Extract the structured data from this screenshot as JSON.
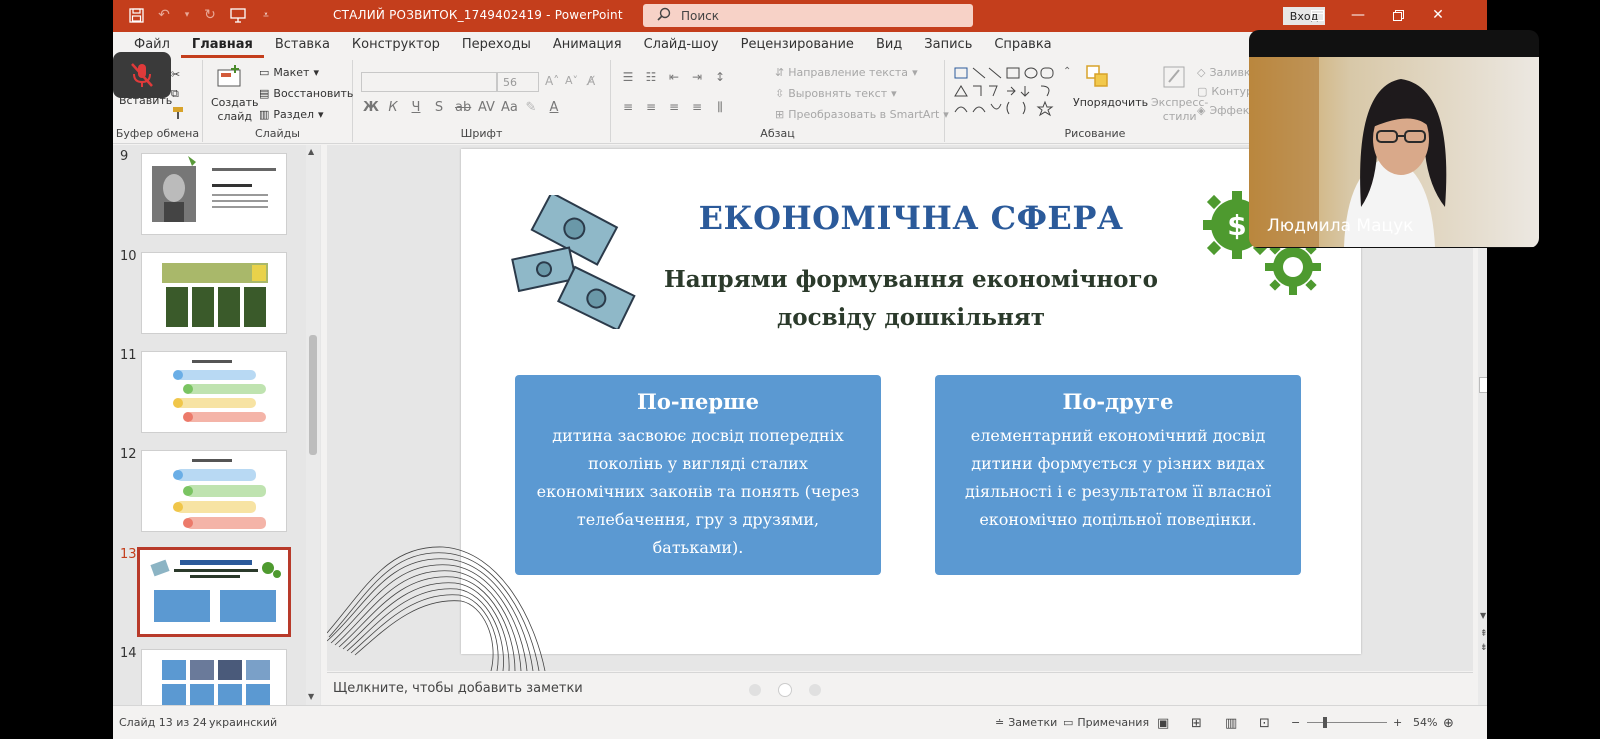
{
  "titlebar": {
    "doc_title": "СТАЛИЙ РОЗВИТОК_1749402419  -  PowerPoint",
    "search_placeholder": "Поиск",
    "signin_label": "Вход"
  },
  "ribbon_tabs": [
    "Файл",
    "Главная",
    "Вставка",
    "Конструктор",
    "Переходы",
    "Анимация",
    "Слайд-шоу",
    "Рецензирование",
    "Вид",
    "Запись",
    "Справка"
  ],
  "ribbon": {
    "clipboard": {
      "paste_label": "Вставить",
      "group_label": "Буфер обмена"
    },
    "slides": {
      "new_slide_label": "Создать\nслайд",
      "layout_label": "Макет",
      "reset_label": "Восстановить",
      "section_label": "Раздел",
      "group_label": "Слайды"
    },
    "font": {
      "size_value": "56",
      "group_label": "Шрифт"
    },
    "paragraph": {
      "text_direction": "Направление текста",
      "align_text": "Выровнять текст",
      "smartart": "Преобразовать в SmartArt",
      "group_label": "Абзац"
    },
    "drawing": {
      "arrange_label": "Упорядочить",
      "quick_styles_label": "Экспресс-\nстили",
      "fill_label": "Заливка",
      "outline_label": "Контур",
      "effects_label": "Эффекты",
      "group_label": "Рисование"
    }
  },
  "thumbnails": [
    {
      "number": "9"
    },
    {
      "number": "10"
    },
    {
      "number": "11"
    },
    {
      "number": "12"
    },
    {
      "number": "13"
    },
    {
      "number": "14"
    }
  ],
  "slide": {
    "title": "ЕКОНОМІЧНА СФЕРА",
    "subtitle": "Напрями формування економічного досвіду дошкільнят",
    "cards": [
      {
        "title": "По-перше",
        "body": "дитина засвоює досвід попередніх поколінь у вигляді сталих економічних законів та понять (через телебачення, гру з друзями, батьками)."
      },
      {
        "title": "По-друге",
        "body": "елементарний економічний досвід дитини формується у різних видах діяльності і є результатом її власної економічно доцільної поведінки."
      }
    ],
    "colors": {
      "title": "#2b5a9a",
      "card": "#5b99d2",
      "gear": "#4e9a2f"
    }
  },
  "notes_placeholder": "Щелкните, чтобы добавить заметки",
  "statusbar": {
    "slide_count": "Слайд 13 из 24",
    "language": "украинский",
    "notes_label": "Заметки",
    "comments_label": "Примечания",
    "zoom_level": "54%"
  },
  "webcam": {
    "participant_name": "Людмила Мацук"
  },
  "accent_color": "#c43e1c"
}
